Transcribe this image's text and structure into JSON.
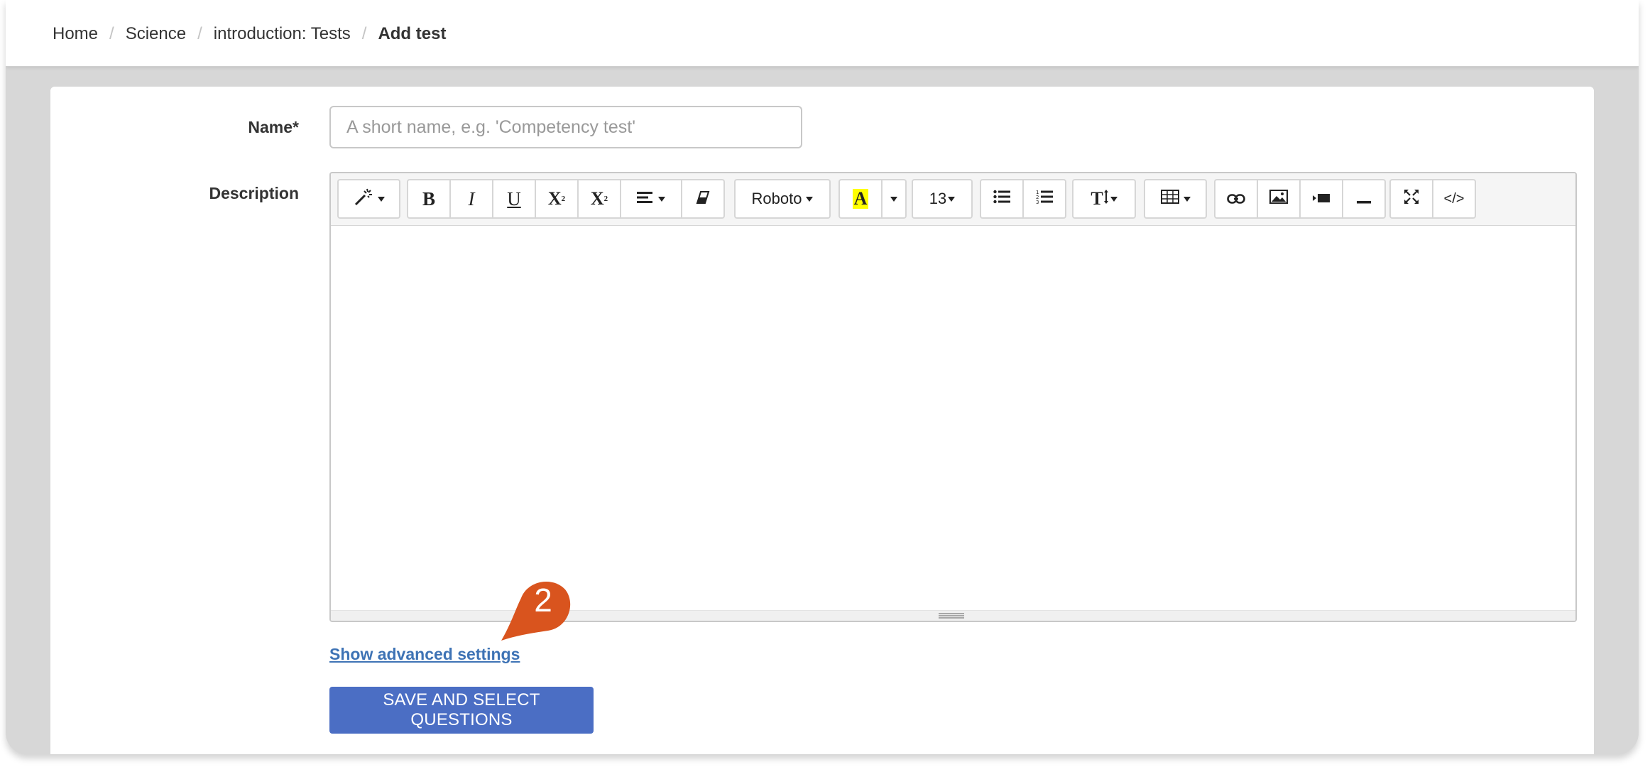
{
  "breadcrumb": {
    "items": [
      "Home",
      "Science",
      "introduction: Tests"
    ],
    "current": "Add test",
    "separator": "/"
  },
  "form": {
    "name_label": "Name*",
    "name_placeholder": "A short name, e.g. 'Competency test'",
    "name_value": "",
    "description_label": "Description"
  },
  "toolbar": {
    "font_name": "Roboto",
    "font_size": "13",
    "highlight_letter": "A",
    "bold": "B",
    "italic": "I",
    "underline": "U",
    "superscript": "X",
    "subscript": "X",
    "code_view": "</>",
    "text_style": "T"
  },
  "advanced_link": "Show advanced settings",
  "save_button": "SAVE AND SELECT QUESTIONS",
  "callout": {
    "number": "2",
    "color": "#d9541e"
  },
  "colors": {
    "primary_button": "#4b6ec4",
    "link": "#3e73b5",
    "highlight_yellow": "#ffff00"
  },
  "icons": [
    "magic-wand-icon",
    "align-icon",
    "eraser-icon",
    "unordered-list-icon",
    "ordered-list-icon",
    "table-icon",
    "link-icon",
    "picture-icon",
    "video-icon",
    "horizontal-rule-icon",
    "fullscreen-icon",
    "code-view-icon"
  ]
}
